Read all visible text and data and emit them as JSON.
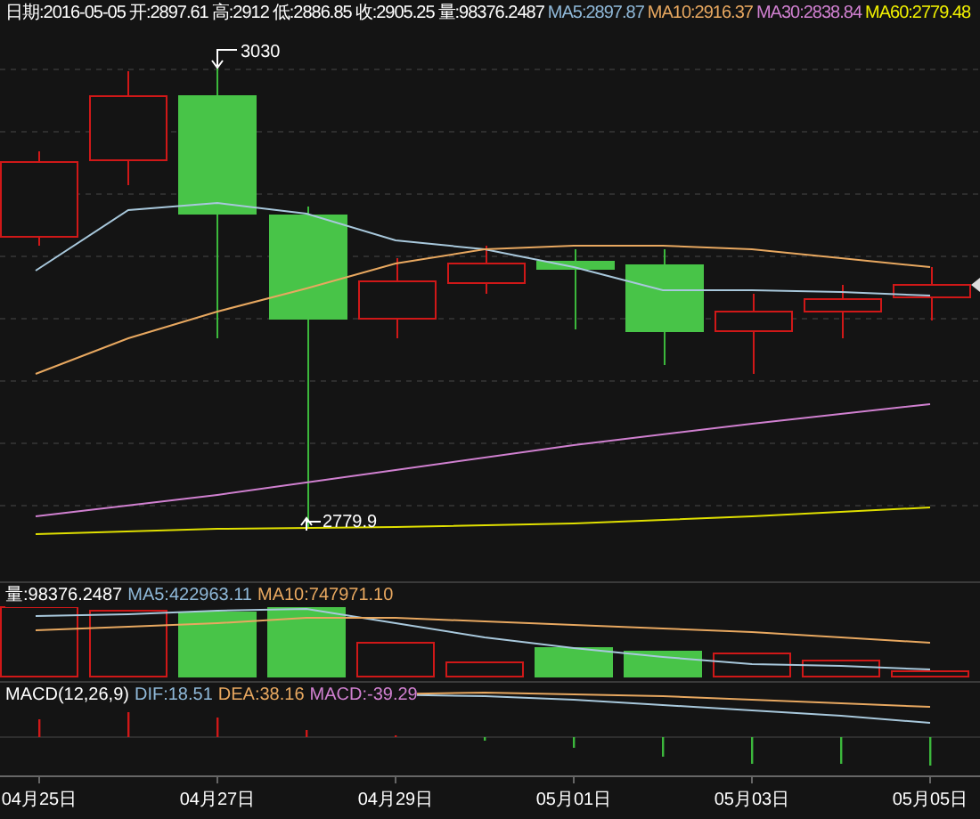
{
  "header": [
    {
      "text": "日期:2016-05-05",
      "color": "#ffffff"
    },
    {
      "text": "开:2897.61",
      "color": "#ffffff"
    },
    {
      "text": "高:2912",
      "color": "#ffffff"
    },
    {
      "text": "低:2886.85",
      "color": "#ffffff"
    },
    {
      "text": "收:2905.25",
      "color": "#ffffff"
    },
    {
      "text": "量:98376.2487",
      "color": "#ffffff"
    },
    {
      "text": "MA5:2897.87",
      "color": "#8fb8d8"
    },
    {
      "text": "MA10:2916.37",
      "color": "#e8a860"
    },
    {
      "text": "MA30:2838.84",
      "color": "#d080d0"
    },
    {
      "text": "MA60:2779.48",
      "color": "#f0f000"
    }
  ],
  "price_callouts": {
    "high": "3030",
    "low": "2779.9"
  },
  "volume_header": [
    {
      "text": "量:98376.2487",
      "color": "#ffffff"
    },
    {
      "text": "MA5:422963.11",
      "color": "#8fb8d8"
    },
    {
      "text": "MA10:747971.10",
      "color": "#e8a860"
    }
  ],
  "macd_header": [
    {
      "text": "MACD(12,26,9)",
      "color": "#ffffff"
    },
    {
      "text": "DIF:18.51",
      "color": "#8fb8d8"
    },
    {
      "text": "DEA:38.16",
      "color": "#e8a860"
    },
    {
      "text": "MACD:-39.29",
      "color": "#d080d0"
    }
  ],
  "x_axis_labels": [
    "04月25日",
    "04月27日",
    "04月29日",
    "05月01日",
    "05月03日",
    "05月05日"
  ]
}
